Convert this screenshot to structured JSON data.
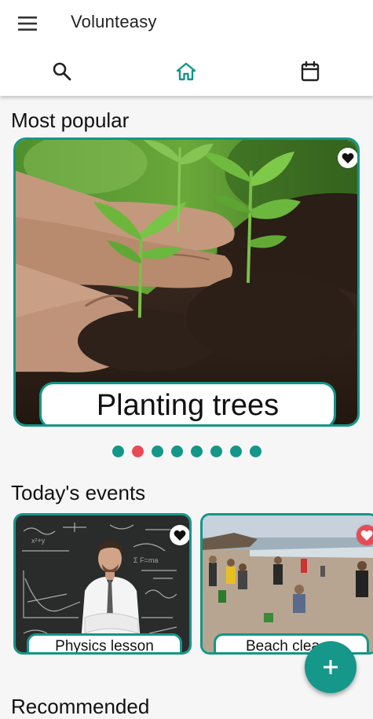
{
  "app": {
    "title": "Volunteasy"
  },
  "tabs": [
    {
      "icon": "search-icon",
      "active": false
    },
    {
      "icon": "home-icon",
      "active": true
    },
    {
      "icon": "calendar-icon",
      "active": false
    }
  ],
  "colors": {
    "accent": "#149688",
    "active_dot": "#e84a55",
    "background": "#f6f6f6"
  },
  "popular": {
    "heading": "Most popular",
    "card": {
      "title": "Planting trees",
      "favorite_icon": "heart-icon"
    },
    "carousel": {
      "total": 8,
      "active_index": 1
    }
  },
  "today": {
    "heading": "Today's events",
    "events": [
      {
        "title": "Physics lesson",
        "favorite_icon": "heart-icon"
      },
      {
        "title": "Beach clea",
        "favorite_icon": "heart-icon"
      }
    ]
  },
  "recommended": {
    "heading": "Recommended"
  },
  "fab": {
    "icon": "plus-icon"
  }
}
